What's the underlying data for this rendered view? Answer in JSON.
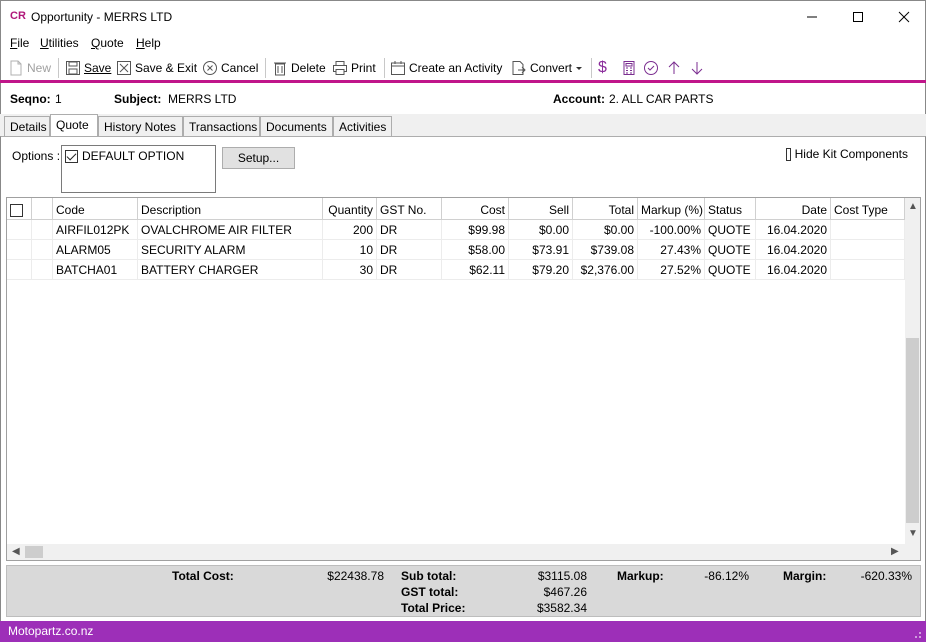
{
  "window": {
    "app_icon": "CR",
    "title": "Opportunity - MERRS LTD"
  },
  "menu": [
    {
      "label_u": "F",
      "label_rest": "ile"
    },
    {
      "label_u": "U",
      "label_rest": "tilities"
    },
    {
      "label_u": "Q",
      "label_rest": "uote"
    },
    {
      "label_u": "H",
      "label_rest": "elp"
    }
  ],
  "toolbar": {
    "new": "New",
    "save": "Save",
    "save_exit": "Save & Exit",
    "cancel": "Cancel",
    "delete": "Delete",
    "print": "Print",
    "create_activity": "Create an Activity",
    "convert": "Convert"
  },
  "header": {
    "seqno_label": "Seqno:",
    "seqno_value": "1",
    "subject_label": "Subject:",
    "subject_value": "MERRS LTD",
    "account_label": "Account:",
    "account_value": "2. ALL CAR PARTS"
  },
  "tabs": [
    "Details",
    "Quote",
    "History Notes",
    "Transactions",
    "Documents",
    "Activities"
  ],
  "active_tab": "Quote",
  "options": {
    "label": "Options :",
    "items": [
      {
        "label": "DEFAULT OPTION",
        "checked": true
      }
    ],
    "setup_button": "Setup...",
    "hide_kit_label": "Hide Kit Components"
  },
  "grid": {
    "columns": [
      "",
      "",
      "Code",
      "Description",
      "Quantity",
      "GST No.",
      "Cost",
      "Sell",
      "Total",
      "Markup (%)",
      "Status",
      "Date",
      "Cost Type"
    ],
    "rows": [
      [
        "",
        "",
        "AIRFIL012PK",
        "OVALCHROME AIR FILTER",
        "200",
        "DR",
        "$99.98",
        "$0.00",
        "$0.00",
        "-100.00%",
        "QUOTE",
        "16.04.2020",
        ""
      ],
      [
        "",
        "",
        "ALARM05",
        "SECURITY ALARM",
        "10",
        "DR",
        "$58.00",
        "$73.91",
        "$739.08",
        "27.43%",
        "QUOTE",
        "16.04.2020",
        ""
      ],
      [
        "",
        "",
        "BATCHA01",
        "BATTERY CHARGER",
        "30",
        "DR",
        "$62.11",
        "$79.20",
        "$2,376.00",
        "27.52%",
        "QUOTE",
        "16.04.2020",
        ""
      ]
    ]
  },
  "totals": {
    "total_cost_label": "Total Cost:",
    "total_cost": "$22438.78",
    "sub_total_label": "Sub total:",
    "sub_total": "$3115.08",
    "gst_total_label": "GST total:",
    "gst_total": "$467.26",
    "total_price_label": "Total Price:",
    "total_price": "$3582.34",
    "markup_label": "Markup:",
    "markup": "-86.12%",
    "margin_label": "Margin:",
    "margin": "-620.33%"
  },
  "status": {
    "text": "Motopartz.co.nz"
  },
  "colors": {
    "accent": "#c0168a",
    "statusbar": "#9d2fb8"
  }
}
